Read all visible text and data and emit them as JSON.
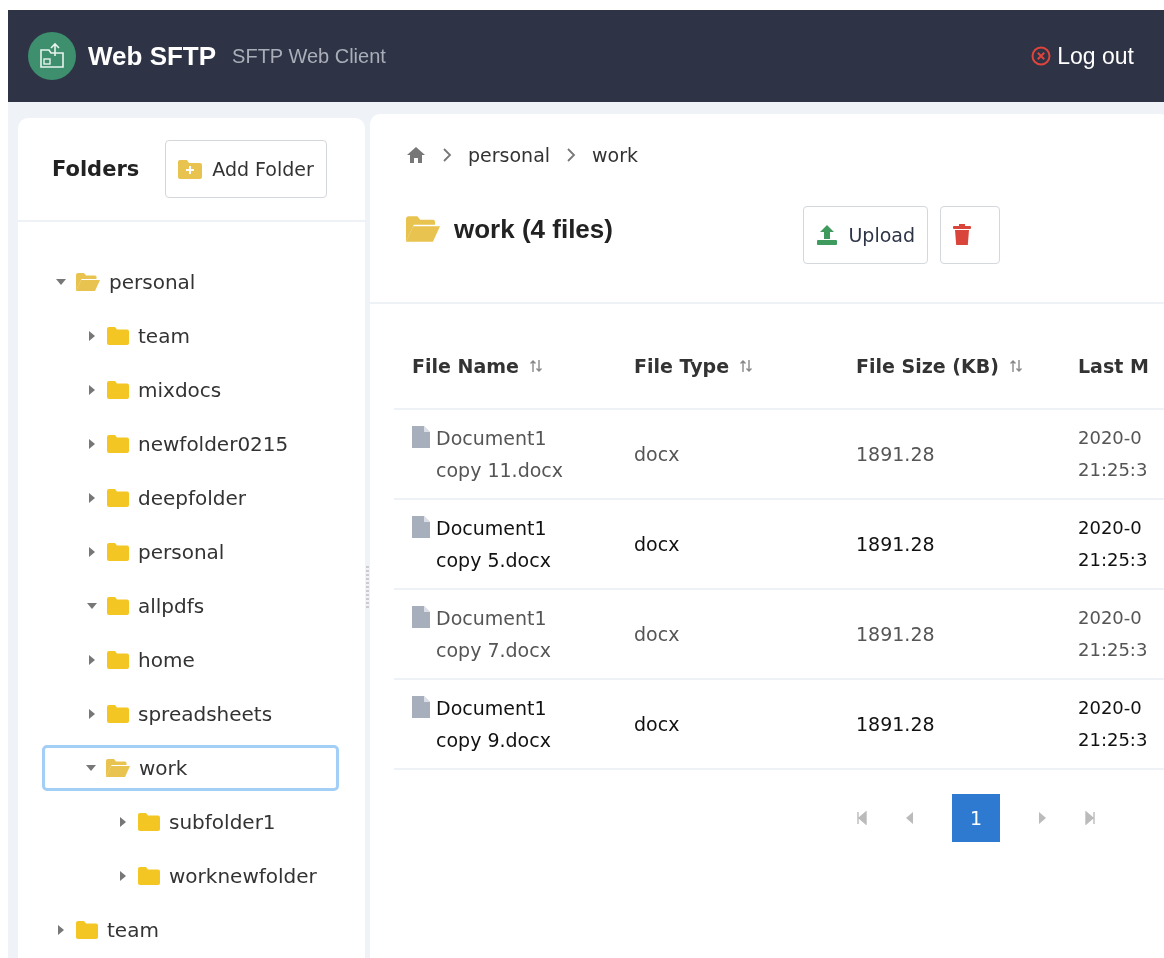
{
  "header": {
    "title": "Web SFTP",
    "subtitle": "SFTP Web Client",
    "logout": "Log out"
  },
  "sidebar": {
    "title": "Folders",
    "add_button": "Add Folder",
    "tree": [
      {
        "label": "personal",
        "expanded": true,
        "open": true,
        "selected": false,
        "children": [
          {
            "label": "team",
            "expanded": false,
            "open": false,
            "selected": false
          },
          {
            "label": "mixdocs",
            "expanded": false,
            "open": false,
            "selected": false
          },
          {
            "label": "newfolder0215",
            "expanded": false,
            "open": false,
            "selected": false
          },
          {
            "label": "deepfolder",
            "expanded": false,
            "open": false,
            "selected": false
          },
          {
            "label": "personal",
            "expanded": false,
            "open": false,
            "selected": false
          },
          {
            "label": "allpdfs",
            "expanded": true,
            "open": false,
            "selected": false
          },
          {
            "label": "home",
            "expanded": false,
            "open": false,
            "selected": false
          },
          {
            "label": "spreadsheets",
            "expanded": false,
            "open": false,
            "selected": false
          },
          {
            "label": "work",
            "expanded": true,
            "open": true,
            "selected": true,
            "children": [
              {
                "label": "subfolder1",
                "expanded": false,
                "open": false,
                "selected": false
              },
              {
                "label": "worknewfolder",
                "expanded": false,
                "open": false,
                "selected": false
              }
            ]
          }
        ]
      },
      {
        "label": "team",
        "expanded": false,
        "open": false,
        "selected": false
      }
    ]
  },
  "breadcrumb": [
    "personal",
    "work"
  ],
  "folder_title": "work (4 files)",
  "actions": {
    "upload": "Upload"
  },
  "table": {
    "columns": [
      "File Name",
      "File Type",
      "File Size (KB)",
      "Last M"
    ],
    "rows": [
      {
        "name": "Document1 copy 11.docx",
        "type": "docx",
        "size": "1891.28",
        "date": "2020-0",
        "time": "21:25:3",
        "dimmed": true
      },
      {
        "name": "Document1 copy 5.docx",
        "type": "docx",
        "size": "1891.28",
        "date": "2020-0",
        "time": "21:25:3",
        "dimmed": false
      },
      {
        "name": "Document1 copy 7.docx",
        "type": "docx",
        "size": "1891.28",
        "date": "2020-0",
        "time": "21:25:3",
        "dimmed": true
      },
      {
        "name": "Document1 copy 9.docx",
        "type": "docx",
        "size": "1891.28",
        "date": "2020-0",
        "time": "21:25:3",
        "dimmed": false
      }
    ]
  },
  "pagination": {
    "pages": [
      {
        "label": "1",
        "selected": true
      }
    ]
  }
}
